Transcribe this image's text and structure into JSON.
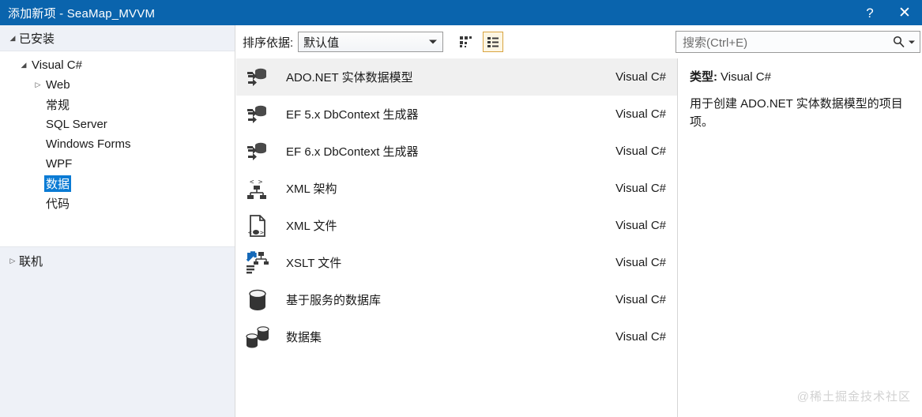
{
  "titlebar": {
    "title": "添加新项 - SeaMap_MVVM",
    "help_label": "?",
    "close_label": "✕"
  },
  "sidebar": {
    "installed_header": "已安装",
    "installed_arrow": "◢",
    "online_header": "联机",
    "online_arrow": "▷",
    "tree": [
      {
        "label": "Visual C#",
        "level": 1,
        "arrow": "◢",
        "selected": false
      },
      {
        "label": "Web",
        "level": 2,
        "arrow": "▷",
        "selected": false
      },
      {
        "label": "常规",
        "level": 2,
        "arrow": "",
        "selected": false
      },
      {
        "label": "SQL Server",
        "level": 2,
        "arrow": "",
        "selected": false
      },
      {
        "label": "Windows Forms",
        "level": 2,
        "arrow": "",
        "selected": false
      },
      {
        "label": "WPF",
        "level": 2,
        "arrow": "",
        "selected": false
      },
      {
        "label": "数据",
        "level": 2,
        "arrow": "",
        "selected": true
      },
      {
        "label": "代码",
        "level": 2,
        "arrow": "",
        "selected": false
      }
    ]
  },
  "toolbar": {
    "sort_label": "排序依据:",
    "sort_value": "默认值",
    "grid_view_name": "grid-view-icon",
    "list_view_name": "list-view-icon",
    "list_view_active": true
  },
  "search": {
    "placeholder": "搜索(Ctrl+E)",
    "value": ""
  },
  "list": {
    "items": [
      {
        "name": "ADO.NET 实体数据模型",
        "lang": "Visual C#",
        "icon": "entity-data-model-icon",
        "selected": true
      },
      {
        "name": "EF 5.x DbContext 生成器",
        "lang": "Visual C#",
        "icon": "entity-data-model-icon",
        "selected": false
      },
      {
        "name": "EF 6.x DbContext 生成器",
        "lang": "Visual C#",
        "icon": "entity-data-model-icon",
        "selected": false
      },
      {
        "name": "XML 架构",
        "lang": "Visual C#",
        "icon": "xml-schema-icon",
        "selected": false
      },
      {
        "name": "XML 文件",
        "lang": "Visual C#",
        "icon": "xml-file-icon",
        "selected": false
      },
      {
        "name": "XSLT 文件",
        "lang": "Visual C#",
        "icon": "xslt-file-icon",
        "selected": false
      },
      {
        "name": "基于服务的数据库",
        "lang": "Visual C#",
        "icon": "database-icon",
        "selected": false
      },
      {
        "name": "数据集",
        "lang": "Visual C#",
        "icon": "dataset-icon",
        "selected": false
      }
    ]
  },
  "detail": {
    "type_label": "类型:",
    "type_value": "Visual C#",
    "description": "用于创建 ADO.NET 实体数据模型的项目项。"
  },
  "watermark": {
    "text": "@稀土掘金技术社区"
  },
  "colors": {
    "titlebar": "#0a64ad",
    "selection": "#0a7bd4",
    "row_selected": "#f0f0f0",
    "sidebar_bg": "#eef1f7",
    "accent_view_btn": "#d9a441"
  }
}
